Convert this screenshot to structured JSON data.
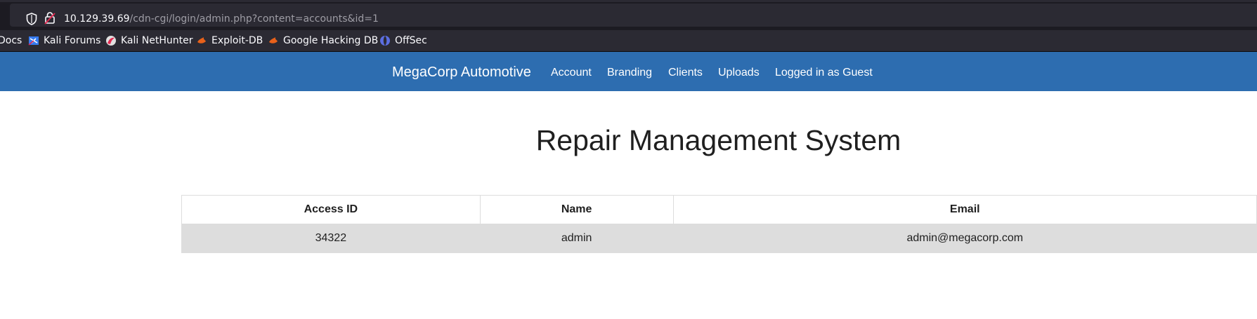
{
  "browser": {
    "url_host": "10.129.39.69",
    "url_path": "/cdn-cgi/login/admin.php?content=accounts&id=1",
    "bookmarks": [
      {
        "label": "Docs",
        "icon": "kali-docs-icon"
      },
      {
        "label": "Kali Forums",
        "icon": "kali-forums-icon"
      },
      {
        "label": "Kali NetHunter",
        "icon": "kali-nethunter-icon"
      },
      {
        "label": "Exploit-DB",
        "icon": "exploit-db-icon"
      },
      {
        "label": "Google Hacking DB",
        "icon": "ghdb-icon"
      },
      {
        "label": "OffSec",
        "icon": "offsec-icon"
      }
    ]
  },
  "navbar": {
    "brand": "MegaCorp Automotive",
    "links": [
      "Account",
      "Branding",
      "Clients",
      "Uploads",
      "Logged in as Guest"
    ],
    "background_color": "#2d6db0"
  },
  "main": {
    "title": "Repair Management System",
    "table": {
      "headers": [
        "Access ID",
        "Name",
        "Email"
      ],
      "rows": [
        [
          "34322",
          "admin",
          "admin@megacorp.com"
        ]
      ]
    }
  }
}
